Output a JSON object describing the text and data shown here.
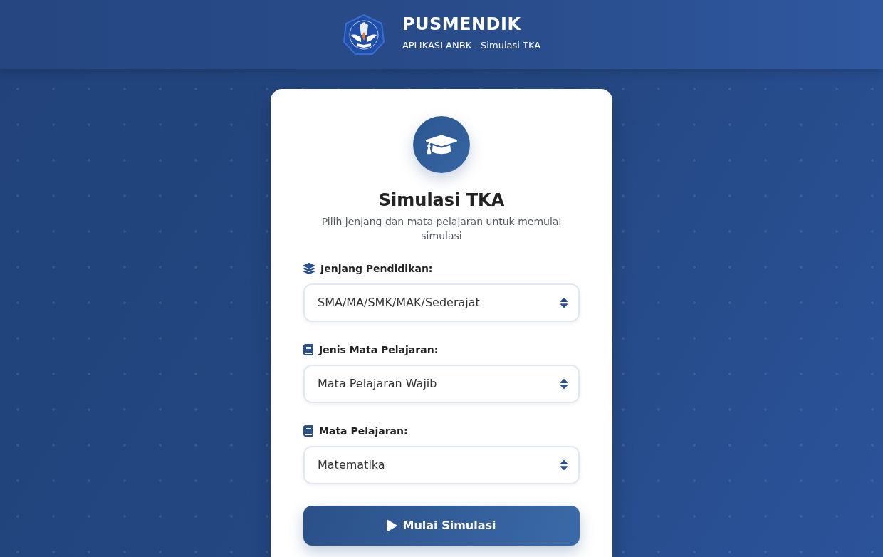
{
  "header": {
    "title": "PUSMENDIK",
    "subtitle": "APLIKASI ANBK - Simulasi TKA"
  },
  "card": {
    "title": "Simulasi TKA",
    "description": "Pilih jenjang dan mata pelajaran untuk memulai simulasi",
    "fields": [
      {
        "kind": "layers",
        "label": "Jenjang Pendidikan:",
        "value": "SMA/MA/SMK/MAK/Sederajat"
      },
      {
        "kind": "book",
        "label": "Jenis Mata Pelajaran:",
        "value": "Mata Pelajaran Wajib"
      },
      {
        "kind": "book",
        "label": "Mata Pelajaran:",
        "value": "Matematika"
      }
    ],
    "submit": {
      "label": "Mulai Simulasi"
    }
  }
}
